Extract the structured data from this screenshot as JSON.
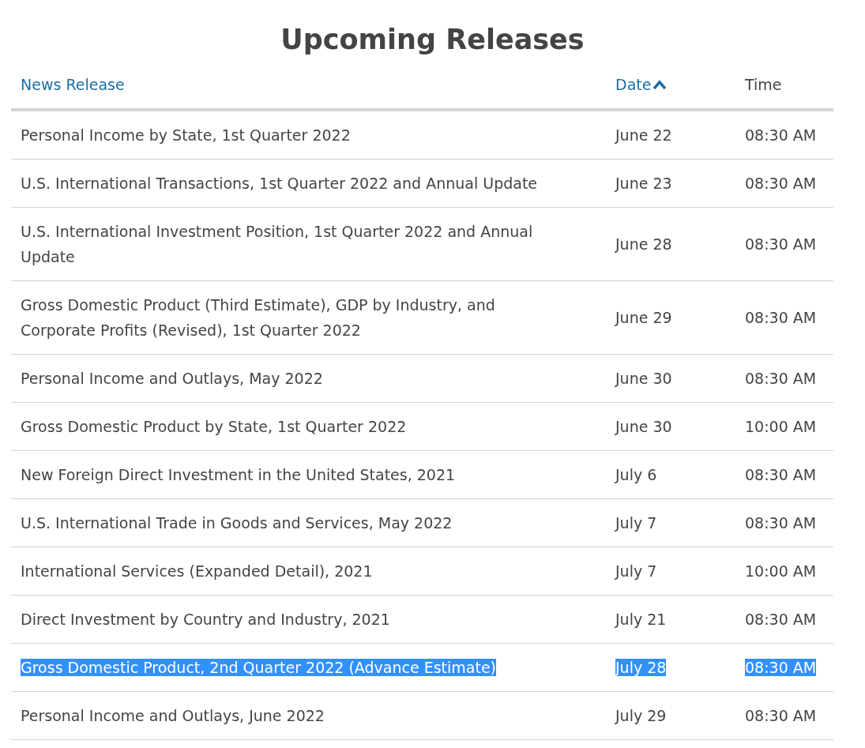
{
  "title": "Upcoming Releases",
  "columns": [
    {
      "label": "News Release",
      "kind": "link",
      "sorted": false
    },
    {
      "label": "Date",
      "kind": "link",
      "sorted": true
    },
    {
      "label": "Time",
      "kind": "plain",
      "sorted": false
    }
  ],
  "rows": [
    {
      "release": "Personal Income by State, 1st Quarter 2022",
      "date": "June 22",
      "time": "08:30 AM",
      "selected": false
    },
    {
      "release": "U.S. International Transactions, 1st Quarter 2022 and Annual Update",
      "date": "June 23",
      "time": "08:30 AM",
      "selected": false
    },
    {
      "release": "U.S. International Investment Position, 1st Quarter 2022 and Annual Update",
      "date": "June 28",
      "time": "08:30 AM",
      "selected": false
    },
    {
      "release": "Gross Domestic Product (Third Estimate), GDP by Industry, and Corporate Profits (Revised), 1st Quarter 2022",
      "date": "June 29",
      "time": "08:30 AM",
      "selected": false
    },
    {
      "release": "Personal Income and Outlays, May 2022",
      "date": "June 30",
      "time": "08:30 AM",
      "selected": false
    },
    {
      "release": "Gross Domestic Product by State, 1st Quarter 2022",
      "date": "June 30",
      "time": "10:00 AM",
      "selected": false
    },
    {
      "release": "New Foreign Direct Investment in the United States, 2021",
      "date": "July 6",
      "time": "08:30 AM",
      "selected": false
    },
    {
      "release": "U.S. International Trade in Goods and Services, May 2022",
      "date": "July 7",
      "time": "08:30 AM",
      "selected": false
    },
    {
      "release": "International Services (Expanded Detail), 2021",
      "date": "July 7",
      "time": "10:00 AM",
      "selected": false
    },
    {
      "release": "Direct Investment by Country and Industry, 2021",
      "date": "July 21",
      "time": "08:30 AM",
      "selected": false
    },
    {
      "release": "Gross Domestic Product, 2nd Quarter 2022 (Advance Estimate)",
      "date": "July 28",
      "time": "08:30 AM",
      "selected": true
    },
    {
      "release": "Personal Income and Outlays, June 2022",
      "date": "July 29",
      "time": "08:30 AM",
      "selected": false
    }
  ]
}
